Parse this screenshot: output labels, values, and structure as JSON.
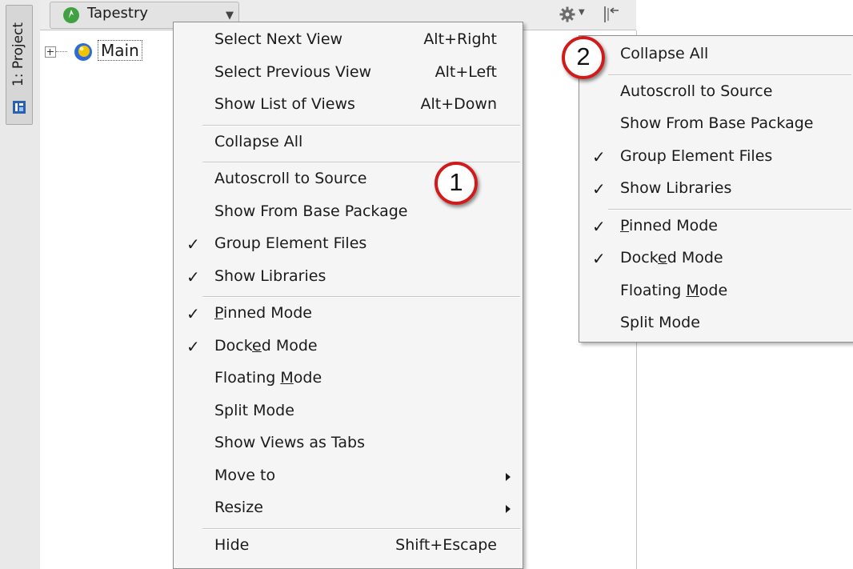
{
  "sidebar": {
    "tab_label": "1: Project"
  },
  "header": {
    "view_selector_label": "Tapestry"
  },
  "tree": {
    "root_label": "Main"
  },
  "menu1": [
    {
      "label": "Select Next View",
      "shortcut": "Alt+Right",
      "checked": false
    },
    {
      "label": "Select Previous View",
      "shortcut": "Alt+Left",
      "checked": false
    },
    {
      "label": "Show List of Views",
      "shortcut": "Alt+Down",
      "checked": false
    },
    {
      "separator": true
    },
    {
      "label": "Collapse All",
      "checked": false
    },
    {
      "separator": true
    },
    {
      "label": "Autoscroll to Source",
      "checked": false
    },
    {
      "label": "Show From Base Package",
      "checked": false
    },
    {
      "label": "Group Element Files",
      "checked": true
    },
    {
      "label": "Show Libraries",
      "checked": true
    },
    {
      "separator": true
    },
    {
      "label": "Pinned Mode",
      "checked": true,
      "mnemonic": 0
    },
    {
      "label": "Docked Mode",
      "checked": true,
      "mnemonic": 4
    },
    {
      "label": "Floating Mode",
      "checked": false,
      "mnemonic": 9
    },
    {
      "label": "Split Mode",
      "checked": false
    },
    {
      "label": "Show Views as Tabs",
      "checked": false
    },
    {
      "label": "Move to",
      "checked": false,
      "submenu": true
    },
    {
      "label": "Resize",
      "checked": false,
      "submenu": true
    },
    {
      "separator": true
    },
    {
      "label": "Hide",
      "shortcut": "Shift+Escape",
      "checked": false
    }
  ],
  "menu2": [
    {
      "label": "Collapse All",
      "checked": false
    },
    {
      "separator": true
    },
    {
      "label": "Autoscroll to Source",
      "checked": false
    },
    {
      "label": "Show From Base Package",
      "checked": false
    },
    {
      "label": "Group Element Files",
      "checked": true
    },
    {
      "label": "Show Libraries",
      "checked": true
    },
    {
      "separator": true
    },
    {
      "label": "Pinned Mode",
      "checked": true,
      "mnemonic": 0
    },
    {
      "label": "Docked Mode",
      "checked": true,
      "mnemonic": 4
    },
    {
      "label": "Floating Mode",
      "checked": false,
      "mnemonic": 9
    },
    {
      "label": "Split Mode",
      "checked": false
    }
  ],
  "check_glyph": "✓",
  "callouts": {
    "one": "1",
    "two": "2"
  },
  "colors": {
    "callout_ring": "#d11b1b",
    "module_icon": "#f4c400",
    "tapestry_icon": "#3fa142"
  }
}
